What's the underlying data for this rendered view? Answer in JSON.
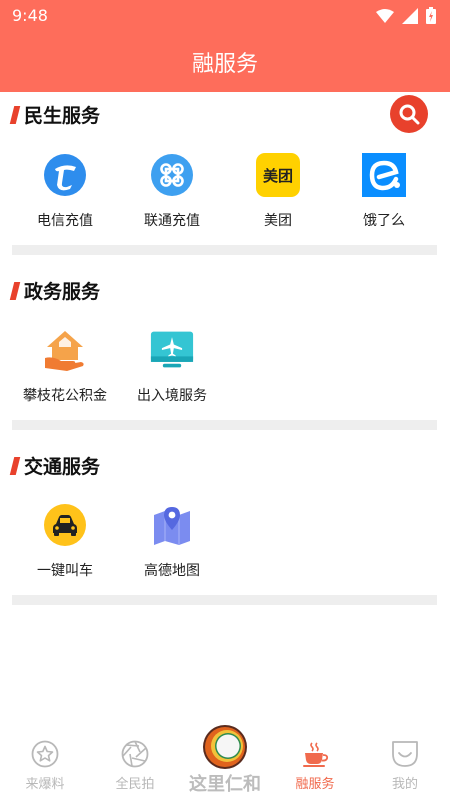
{
  "status_bar": {
    "time": "9:48"
  },
  "header": {
    "title": "融服务"
  },
  "sections": [
    {
      "title": "民生服务",
      "items": [
        {
          "label": "电信充值",
          "icon": "telecom-icon"
        },
        {
          "label": "联通充值",
          "icon": "unicom-icon"
        },
        {
          "label": "美团",
          "icon": "meituan-icon",
          "icon_text": "美团"
        },
        {
          "label": "饿了么",
          "icon": "eleme-icon"
        }
      ]
    },
    {
      "title": "政务服务",
      "items": [
        {
          "label": "攀枝花公积金",
          "icon": "house-fund-icon"
        },
        {
          "label": "出入境服务",
          "icon": "airplane-monitor-icon"
        }
      ]
    },
    {
      "title": "交通服务",
      "items": [
        {
          "label": "一键叫车",
          "icon": "taxi-icon"
        },
        {
          "label": "高德地图",
          "icon": "map-pin-icon"
        }
      ]
    }
  ],
  "tabbar": {
    "items": [
      {
        "label": "来爆料",
        "icon": "star-badge-icon"
      },
      {
        "label": "全民拍",
        "icon": "camera-aperture-icon"
      },
      {
        "label": "这里仁和",
        "icon": "app-logo-icon"
      },
      {
        "label": "融服务",
        "icon": "coffee-cup-icon",
        "active": true
      },
      {
        "label": "我的",
        "icon": "smile-icon"
      }
    ]
  },
  "colors": {
    "header": "#fe6d5b",
    "accent": "#e8412c",
    "tab_active": "#f06a4d",
    "tab_inactive": "#b8b8b8"
  }
}
